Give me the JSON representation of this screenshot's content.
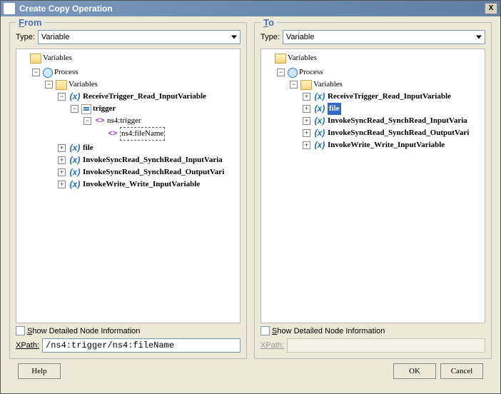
{
  "dialog": {
    "title": "Create Copy Operation",
    "close_label": "X"
  },
  "from": {
    "heading_first": "F",
    "heading_rest": "rom",
    "type_label": "Type:",
    "type_value": "Variable",
    "detail_checkbox_first": "S",
    "detail_checkbox_rest": "how Detailed Node Information",
    "xpath_label_first": "X",
    "xpath_label_rest": "Path:",
    "xpath_value": "/ns4:trigger/ns4:fileName",
    "tree": {
      "root": "Variables",
      "process": "Process",
      "vars_folder": "Variables",
      "v0": "ReceiveTrigger_Read_InputVariable",
      "v0_part": "trigger",
      "v0_elem": "ns4:trigger",
      "v0_attr": "ns4:fileName",
      "v1": "file",
      "v2": "InvokeSyncRead_SynchRead_InputVaria",
      "v3": "InvokeSyncRead_SynchRead_OutputVari",
      "v4": "InvokeWrite_Write_InputVariable"
    }
  },
  "to": {
    "heading_first": "T",
    "heading_rest": "o",
    "type_label": "Type:",
    "type_value": "Variable",
    "detail_checkbox_first": "S",
    "detail_checkbox_rest": "how Detailed Node Information",
    "xpath_label": "XPath:",
    "xpath_value": "",
    "tree": {
      "root": "Variables",
      "process": "Process",
      "vars_folder": "Variables",
      "v0": "ReceiveTrigger_Read_InputVariable",
      "v1": "file",
      "v2": "InvokeSyncRead_SynchRead_InputVaria",
      "v3": "InvokeSyncRead_SynchRead_OutputVari",
      "v4": "InvokeWrite_Write_InputVariable"
    }
  },
  "buttons": {
    "help": "Help",
    "ok": "OK",
    "cancel": "Cancel"
  }
}
